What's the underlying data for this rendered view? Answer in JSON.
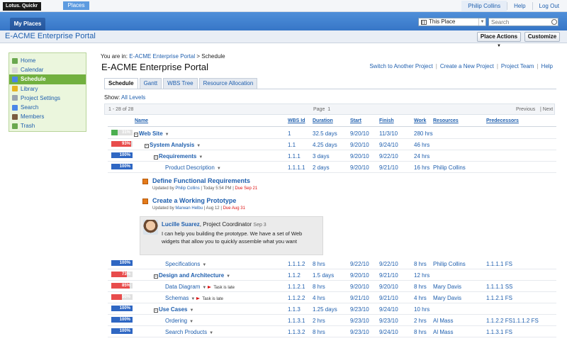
{
  "topbar": {
    "logo": "Lotus. Quickr",
    "places": "Places",
    "user": "Philip Collins",
    "help": "Help",
    "logout": "Log Out"
  },
  "header": {
    "my_places": "My Places",
    "scope": "This Place",
    "search_placeholder": "Search"
  },
  "titlebar": {
    "title": "E-ACME Enterprise Portal",
    "place_actions": "Place Actions",
    "customize": "Customize"
  },
  "sidebar": {
    "items": [
      {
        "label": "Home",
        "color": "#6aa84f"
      },
      {
        "label": "Calendar",
        "color": "#d9d9d9"
      },
      {
        "label": "Schedule",
        "color": "#4a86e8"
      },
      {
        "label": "Library",
        "color": "#e6b422"
      },
      {
        "label": "Project Settings",
        "color": "#9aa4af"
      },
      {
        "label": "Search",
        "color": "#4a86e8"
      },
      {
        "label": "Members",
        "color": "#7a5c3e"
      },
      {
        "label": "Trash",
        "color": "#6aa84f"
      }
    ]
  },
  "content": {
    "breadcrumb_prefix": "You are in:",
    "breadcrumb_link": "E-ACME Enterprise Portal",
    "breadcrumb_sep": ">",
    "breadcrumb_current": "Schedule",
    "heading": "E-ACME Enterprise Portal",
    "links": [
      "Switch to Another Project",
      "Create a New Project",
      "Project Team",
      "Help"
    ],
    "tabs": [
      "Schedule",
      "Gantt",
      "WBS Tree",
      "Resource Allocation"
    ],
    "show_label": "Show:",
    "show_value": "All Levels"
  },
  "pager": {
    "count": "1 - 28 of 28",
    "page_label": "Page",
    "page_num": "1",
    "prev": "Previous",
    "next": "Next"
  },
  "columns": [
    "Name",
    "WBS Id",
    "Duration",
    "Start",
    "Finish",
    "Work",
    "Resources",
    "Predecessors"
  ],
  "rows": [
    {
      "pct": "31%",
      "fill": 0.31,
      "fill_color": "#4caf50",
      "name": "Web Site",
      "bold": true,
      "expand": true,
      "indent": 0,
      "wbs": "1",
      "duration": "32.5 days",
      "start": "9/20/10",
      "finish": "11/3/10",
      "work": "280 hrs",
      "resources": "",
      "pred": ""
    },
    {
      "pct": "93%",
      "fill": 0.93,
      "fill_color": "#e84c4c",
      "name": "System Analysis",
      "bold": true,
      "expand": true,
      "indent": 1,
      "wbs": "1.1",
      "duration": "4.25 days",
      "start": "9/20/10",
      "finish": "9/24/10",
      "work": "46 hrs",
      "resources": "",
      "pred": ""
    },
    {
      "pct": "100%",
      "fill": 0,
      "fill_color": "#2f67c3",
      "name": "Requirements",
      "bold": true,
      "expand": true,
      "indent": 2,
      "wbs": "1.1.1",
      "duration": "3 days",
      "start": "9/20/10",
      "finish": "9/22/10",
      "work": "24 hrs",
      "resources": "",
      "pred": ""
    },
    {
      "pct": "100%",
      "fill": 0,
      "fill_color": "#2f67c3",
      "name": "Product Description",
      "bold": false,
      "expand": false,
      "indent": 3,
      "wbs": "1.1.1.1",
      "duration": "2 days",
      "start": "9/20/10",
      "finish": "9/21/10",
      "work": "16 hrs",
      "resources": "Philip Collins",
      "pred": ""
    }
  ],
  "rows2": [
    {
      "pct": "100%",
      "fill": 0,
      "fill_color": "#2f67c3",
      "name": "Specifications",
      "bold": false,
      "expand": false,
      "indent": 3,
      "wbs": "1.1.1.2",
      "duration": "8 hrs",
      "start": "9/22/10",
      "finish": "9/22/10",
      "work": "8 hrs",
      "resources": "Philip Collins",
      "pred": "1.1.1.1 FS",
      "late": ""
    },
    {
      "pct": "73%",
      "fill": 0.73,
      "fill_color": "#e84c4c",
      "name": "Design and Architecture",
      "bold": true,
      "expand": true,
      "indent": 2,
      "wbs": "1.1.2",
      "duration": "1.5 days",
      "start": "9/20/10",
      "finish": "9/21/10",
      "work": "12 hrs",
      "resources": "",
      "pred": "",
      "late": ""
    },
    {
      "pct": "85%",
      "fill": 0.85,
      "fill_color": "#e84c4c",
      "name": "Data Diagram",
      "bold": false,
      "expand": false,
      "indent": 3,
      "wbs": "1.1.2.1",
      "duration": "8 hrs",
      "start": "9/20/10",
      "finish": "9/20/10",
      "work": "8 hrs",
      "resources": "Mary Davis",
      "pred": "1.1.1.1 SS",
      "late": "Task is late"
    },
    {
      "pct": "50%",
      "fill": 0.5,
      "fill_color": "#e84c4c",
      "name": "Schemas",
      "bold": false,
      "expand": false,
      "indent": 3,
      "wbs": "1.1.2.2",
      "duration": "4 hrs",
      "start": "9/21/10",
      "finish": "9/21/10",
      "work": "4 hrs",
      "resources": "Mary Davis",
      "pred": "1.1.2.1 FS",
      "late": "Task is late"
    },
    {
      "pct": "100%",
      "fill": 0,
      "fill_color": "#2f67c3",
      "name": "Use Cases",
      "bold": true,
      "expand": true,
      "indent": 2,
      "wbs": "1.1.3",
      "duration": "1.25 days",
      "start": "9/23/10",
      "finish": "9/24/10",
      "work": "10 hrs",
      "resources": "",
      "pred": "",
      "late": ""
    },
    {
      "pct": "100%",
      "fill": 0,
      "fill_color": "#2f67c3",
      "name": "Ordering",
      "bold": false,
      "expand": false,
      "indent": 3,
      "wbs": "1.1.3.1",
      "duration": "2 hrs",
      "start": "9/23/10",
      "finish": "9/23/10",
      "work": "2 hrs",
      "resources": "Al Mass",
      "pred": "1.1.2.2 FS1.1.1.2 FS",
      "late": ""
    },
    {
      "pct": "100%",
      "fill": 0,
      "fill_color": "#2f67c3",
      "name": "Search Products",
      "bold": false,
      "expand": false,
      "indent": 3,
      "wbs": "1.1.3.2",
      "duration": "8 hrs",
      "start": "9/23/10",
      "finish": "9/24/10",
      "work": "8 hrs",
      "resources": "Al Mass",
      "pred": "1.1.3.1 FS",
      "late": ""
    }
  ],
  "activities": [
    {
      "title": "Define Functional Requirements",
      "meta_prefix": "Updated by",
      "user": "Philip Collins",
      "when": "Today 5:54 PM",
      "due": "Due Sep 21"
    },
    {
      "title": "Create a Working Prototype",
      "meta_prefix": "Updated by",
      "user": "Marwan Helbu",
      "when": "Aug 12",
      "due": "Due Aug 31"
    }
  ],
  "comment": {
    "name": "Lucille Suarez",
    "role": ", Project Coordinator",
    "date": "Sep 3",
    "text": "I can help you building the prototype. We have a set of Web widgets that allow you to quickly assemble what you want"
  }
}
